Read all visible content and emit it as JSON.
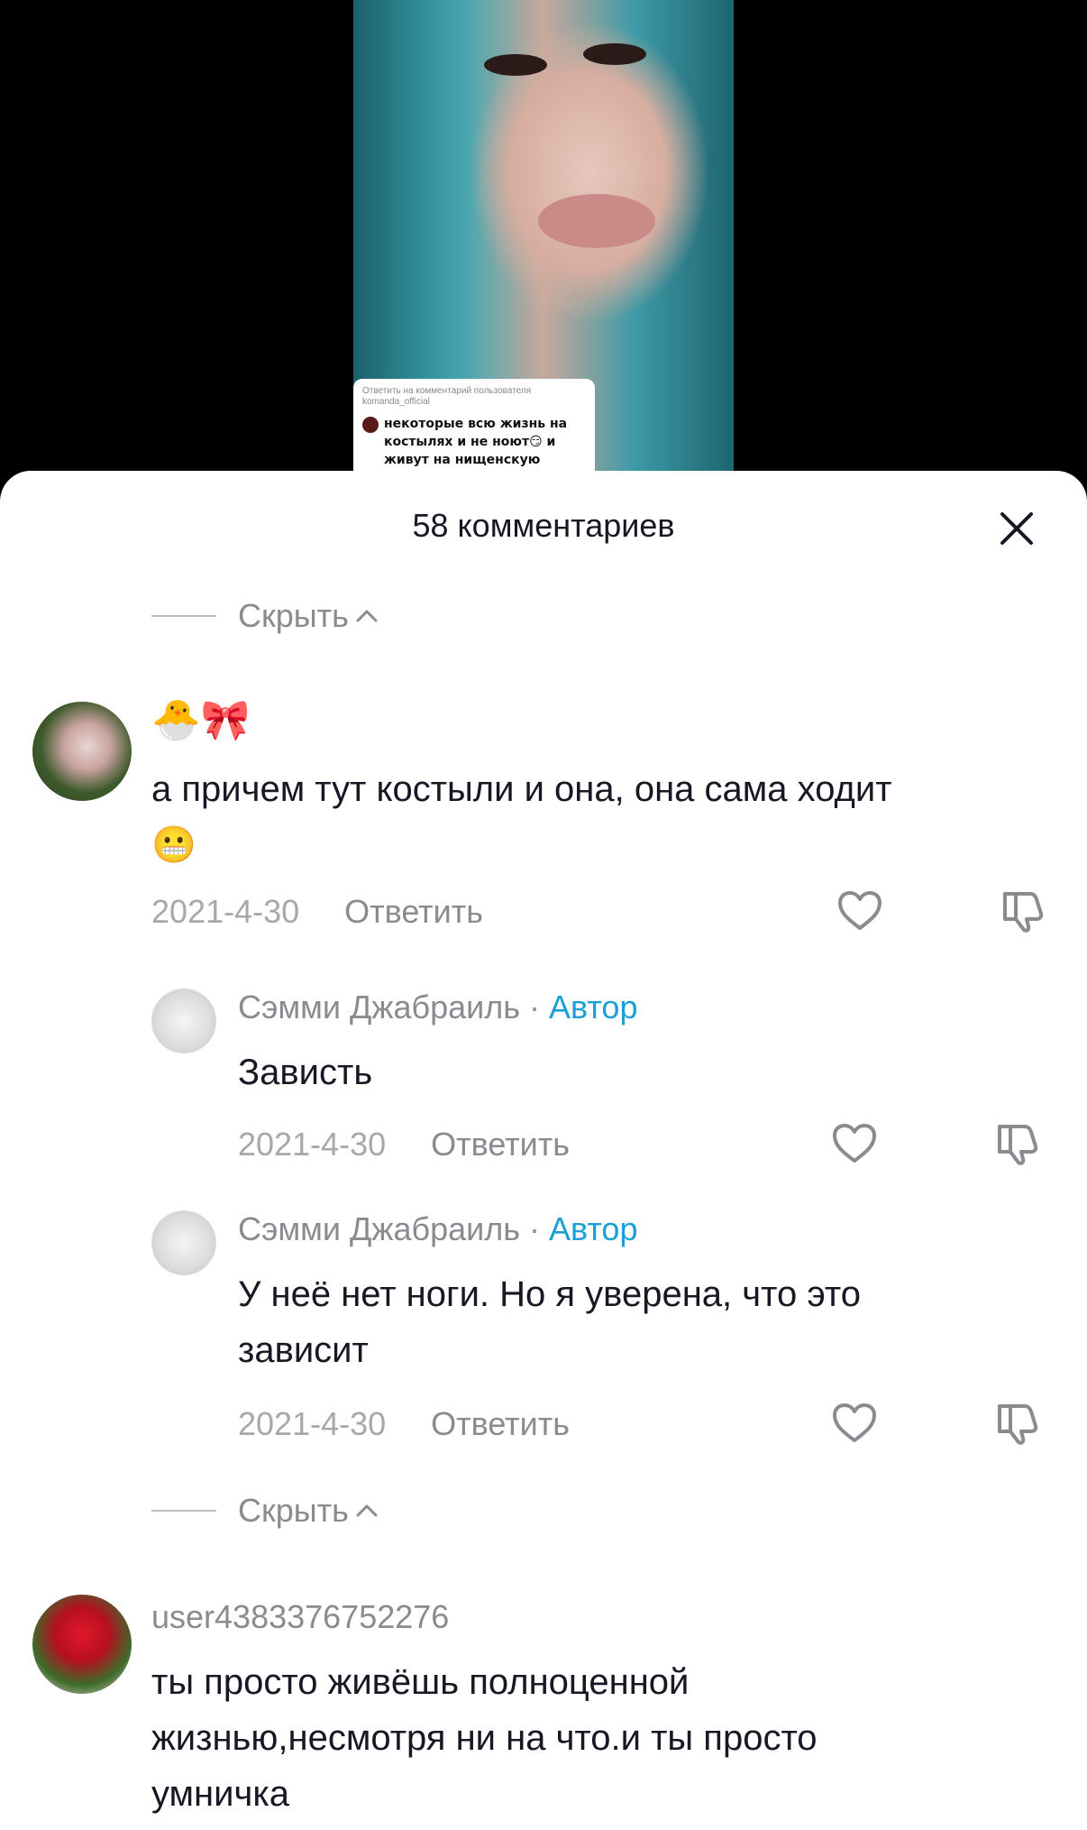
{
  "video": {
    "reply_card": {
      "header": "Ответить на комментарий пользователя komanda_official",
      "text": "некоторые всю жизнь на костылях и не ноют😏 и живут на нищенскую"
    }
  },
  "sheet": {
    "title": "58 комментариев",
    "hide_label_top": "Скрыть",
    "hide_label_bottom": "Скрыть"
  },
  "comments": [
    {
      "username": "🐣🎀",
      "text_line1": "а причем тут костыли и она, она сама ходит",
      "text_line2": "😬",
      "date": "2021-4-30",
      "reply_label": "Ответить"
    },
    {
      "username": "Сэмми Джабраиль",
      "separator": "·",
      "author_tag": "Автор",
      "text": "Зависть",
      "date": "2021-4-30",
      "reply_label": "Ответить"
    },
    {
      "username": "Сэмми Джабраиль",
      "separator": "·",
      "author_tag": "Автор",
      "text_line1": "У неё нет ноги. Но я уверена, что это",
      "text_line2": "зависит",
      "date": "2021-4-30",
      "reply_label": "Ответить"
    },
    {
      "username": "user4383376752276",
      "text_line1": "ты просто живёшь полноценной",
      "text_line2": "жизнью,несмотря ни на что.и ты просто",
      "text_line3": "умничка"
    }
  ],
  "icons": {
    "close": "close-icon",
    "like": "heart-outline-icon",
    "dislike": "thumbs-down-icon",
    "chevron": "chevron-up-icon"
  },
  "colors": {
    "author_tag": "#1aa0d6",
    "text_primary": "#161823",
    "text_secondary": "#8a8b91"
  }
}
